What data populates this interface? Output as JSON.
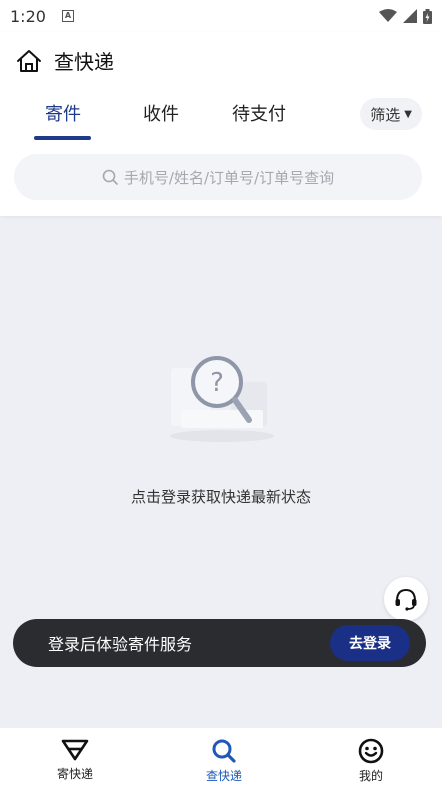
{
  "status_bar": {
    "time": "1:20",
    "notification_badge": "A"
  },
  "header": {
    "title": "查快递"
  },
  "tabs": [
    {
      "label": "寄件",
      "active": true
    },
    {
      "label": "收件",
      "active": false
    },
    {
      "label": "待支付",
      "active": false
    }
  ],
  "filter": {
    "label": "筛选"
  },
  "search": {
    "placeholder": "手机号/姓名/订单号/订单号查询"
  },
  "empty_state": {
    "message": "点击登录获取快递最新状态"
  },
  "login_banner": {
    "text": "登录后体验寄件服务",
    "button_label": "去登录"
  },
  "bottom_nav": [
    {
      "label": "寄快递",
      "icon": "send-triangle-icon",
      "active": false
    },
    {
      "label": "查快递",
      "icon": "search-icon",
      "active": true
    },
    {
      "label": "我的",
      "icon": "smiley-icon",
      "active": false
    }
  ],
  "colors": {
    "accent": "#1e3a8a",
    "nav_active": "#1e58b8",
    "banner_bg": "#2b2c30",
    "login_button": "#1a2f86"
  }
}
